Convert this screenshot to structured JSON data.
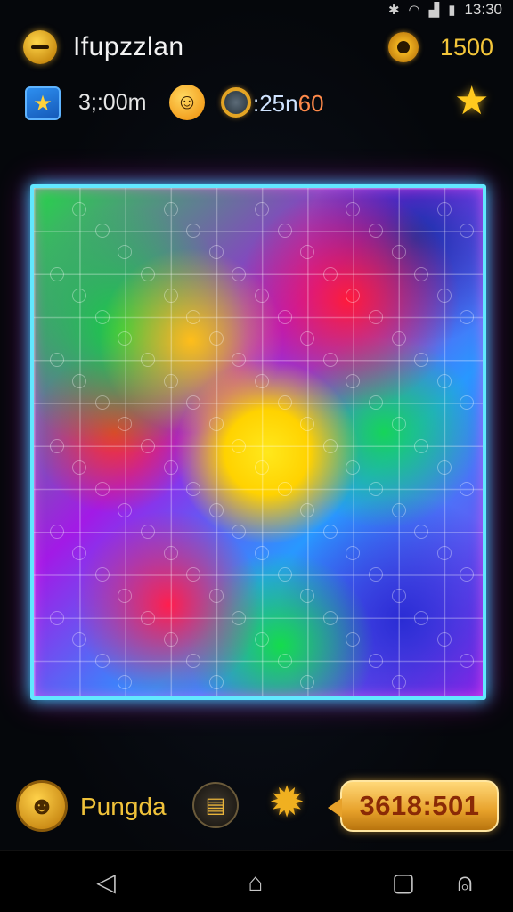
{
  "status_bar": {
    "time": "13:30"
  },
  "header": {
    "title": "Ifupzzlan",
    "coins": "1500"
  },
  "stats": {
    "time": "3;:00m",
    "score_a": ":25n",
    "score_b": "60"
  },
  "bottom": {
    "player_name": "Pungda",
    "points": "3618:501"
  },
  "colors": {
    "board_border": "#62e8ff",
    "accent_gold": "#f3c53a",
    "board_glow": "#ff00e6"
  },
  "icons": {
    "menu": "menu-icon",
    "gear": "gear-icon",
    "star_badge": "star-badge-icon",
    "smiley": "smiley-icon",
    "globe": "globe-icon",
    "star": "star-icon",
    "avatar": "avatar-icon",
    "chat": "chat-icon",
    "badge": "badge-icon",
    "back": "back-icon",
    "home": "home-icon",
    "recents": "recents-icon",
    "assist": "assist-icon"
  }
}
